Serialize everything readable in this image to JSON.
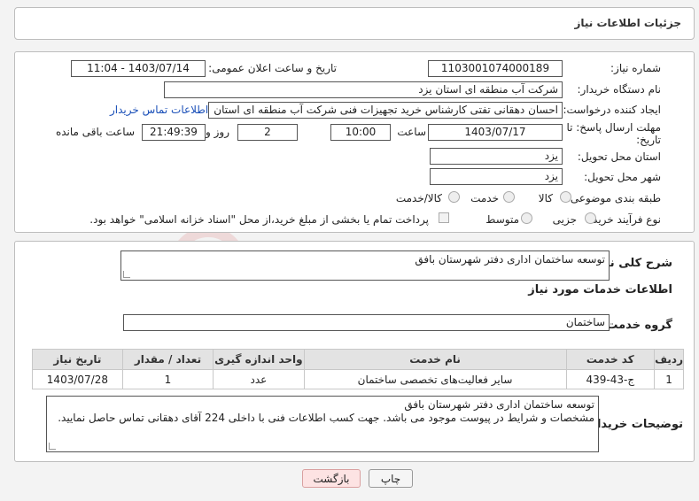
{
  "header": {
    "title": "جزئیات اطلاعات نیاز"
  },
  "form": {
    "need_number_label": "شماره نیاز:",
    "need_number": "1103001074000189",
    "announce_label": "تاریخ و ساعت اعلان عمومی:",
    "announce_value": "1403/07/14 - 11:04",
    "buyer_org_label": "نام دستگاه خریدار:",
    "buyer_org": "شرکت آب منطقه ای استان یزد",
    "creator_label": "ایجاد کننده درخواست:",
    "creator": "احسان دهقانی تفتی کارشناس خرید تجهیزات فنی شرکت آب منطقه ای استان",
    "contact_link": "اطلاعات تماس خریدار",
    "deadline_label_1": "مهلت ارسال پاسخ: تا",
    "deadline_label_2": "تاریخ:",
    "deadline_date": "1403/07/17",
    "time_label": "ساعت",
    "deadline_time": "10:00",
    "days_value": "2",
    "days_label": "روز و",
    "remaining_time": "21:49:39",
    "remaining_label": "ساعت باقی مانده",
    "province_label": "استان محل تحویل:",
    "province": "یزد",
    "city_label": "شهر محل تحویل:",
    "city": "یزد",
    "category_label": "طبقه بندی موضوعی:",
    "category_options": [
      "کالا",
      "خدمت",
      "کالا/خدمت"
    ],
    "process_label": "نوع فرآیند خرید :",
    "process_options": [
      "جزیی",
      "متوسط"
    ],
    "payment_note": "پرداخت تمام یا بخشی از مبلغ خرید،از محل \"اسناد خزانه اسلامی\" خواهد بود."
  },
  "summary": {
    "label": "شرح کلی نیاز:",
    "text": "توسعه ساختمان اداری دفتر شهرستان بافق"
  },
  "services": {
    "section_title": "اطلاعات خدمات مورد نیاز",
    "group_label": "گروه خدمت:",
    "group_value": "ساختمان",
    "columns": [
      "ردیف",
      "کد خدمت",
      "نام خدمت",
      "واحد اندازه گیری",
      "تعداد / مقدار",
      "تاریخ نیاز"
    ],
    "rows": [
      [
        "1",
        "ج-43-439",
        "سایر فعالیت‌های تخصصی ساختمان",
        "عدد",
        "1",
        "1403/07/28"
      ]
    ]
  },
  "buyer_notes": {
    "label": "توضیحات خریدار:",
    "line1": "توسعه ساختمان اداری دفتر شهرستان بافق",
    "line2": "مشخصات و شرایط در پیوست موجود می باشد. جهت کسب اطلاعات فنی با داخلی 224 آقای دهقانی تماس حاصل نمایید."
  },
  "buttons": {
    "print": "چاپ",
    "back": "بازگشت"
  },
  "watermark": {
    "text": "AriaTender.neT"
  }
}
